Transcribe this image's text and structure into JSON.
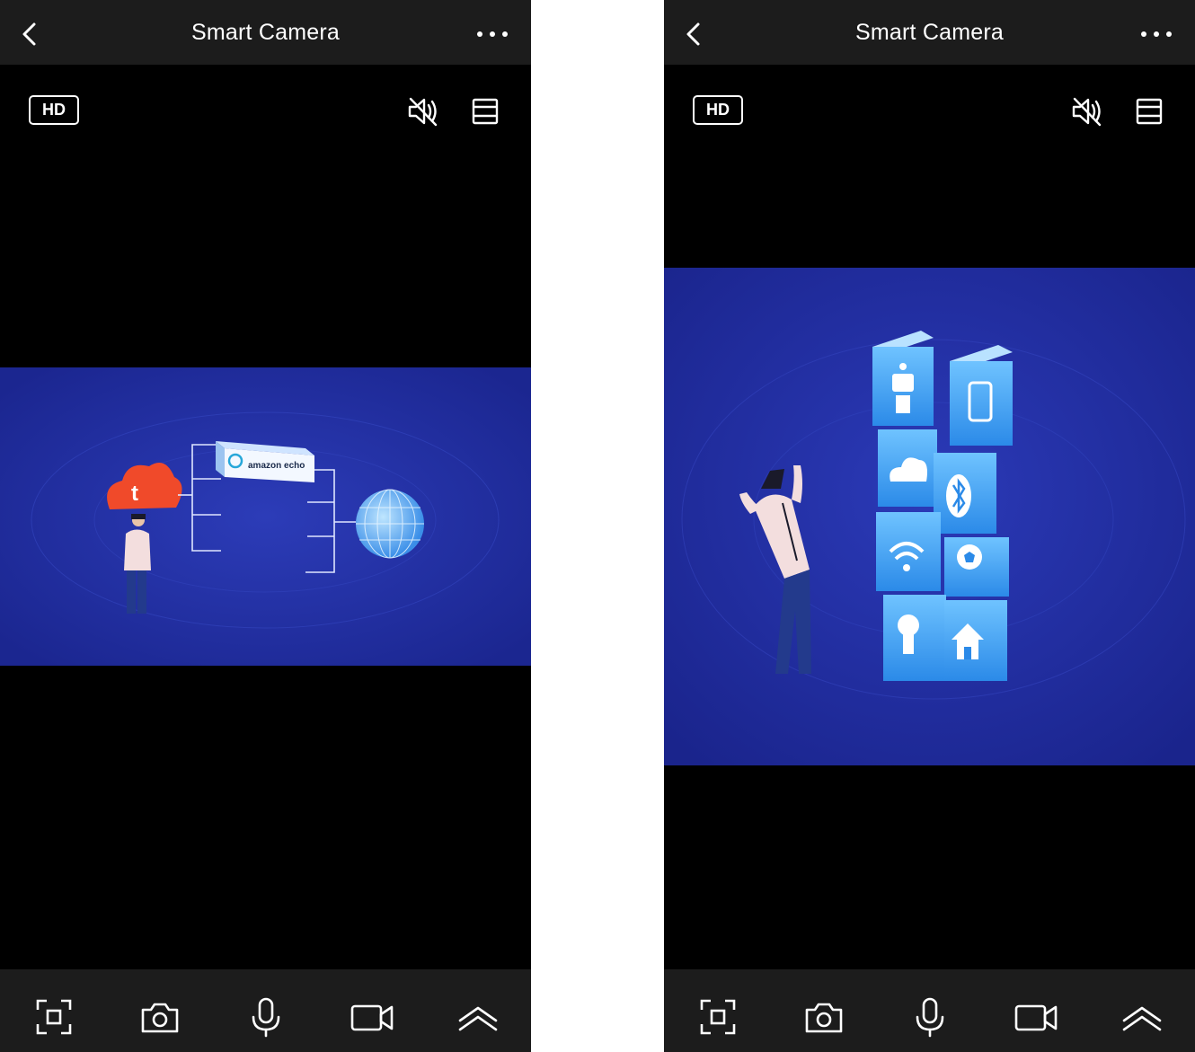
{
  "screens": [
    {
      "header": {
        "title": "Smart Camera",
        "back_icon": "chevron-left-icon",
        "more_icon": "more-horizontal-icon"
      },
      "controls": {
        "hd_label": "HD",
        "mute_icon": "speaker-muted-icon",
        "layout_icon": "layout-toggle-icon"
      },
      "video": {
        "scene": "cloud-echo-globe",
        "echo_label": "amazon echo"
      },
      "toolbar": {
        "icons": [
          "screenshot-crop-icon",
          "camera-icon",
          "microphone-icon",
          "video-record-icon",
          "expand-up-icon"
        ]
      }
    },
    {
      "header": {
        "title": "Smart Camera",
        "back_icon": "chevron-left-icon",
        "more_icon": "more-horizontal-icon"
      },
      "controls": {
        "hd_label": "HD",
        "mute_icon": "speaker-muted-icon",
        "layout_icon": "layout-toggle-icon"
      },
      "video": {
        "scene": "smart-home-blocks"
      },
      "toolbar": {
        "icons": [
          "screenshot-crop-icon",
          "camera-icon",
          "microphone-icon",
          "video-record-icon",
          "expand-up-icon"
        ]
      }
    }
  ],
  "colors": {
    "bar_background": "#1c1c1c",
    "screen_background": "#000000",
    "icon_color": "#ffffff",
    "video_blue": "#2130a0",
    "cloud_orange": "#f04a2a"
  }
}
